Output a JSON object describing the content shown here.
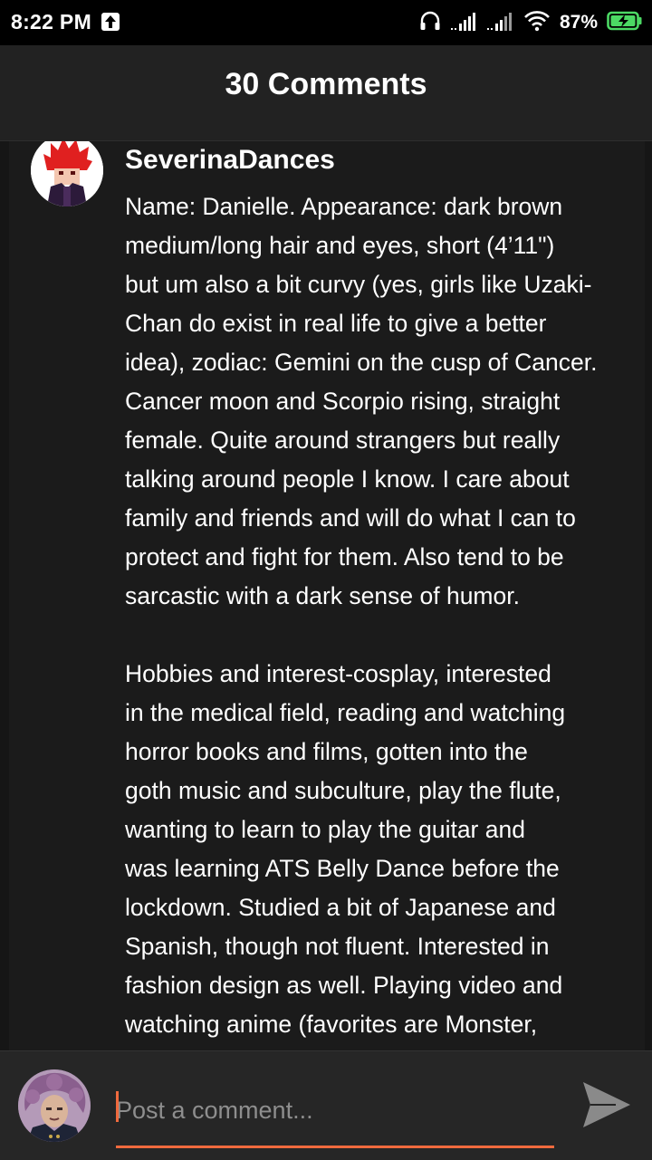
{
  "status_bar": {
    "time": "8:22 PM",
    "battery": "87%",
    "icons": [
      "upload-icon",
      "headphones-icon",
      "signal-icon",
      "signal-icon",
      "wifi-icon",
      "battery-charging-icon"
    ]
  },
  "header": {
    "title": "30 Comments"
  },
  "comment": {
    "username": "SeverinaDances",
    "lines": [
      "Name: Danielle. Appearance: dark brown",
      "medium/long hair and eyes, short (4’11\")",
      "but um also a bit curvy (yes, girls like Uzaki-",
      "Chan do exist in real life to give a better",
      "idea), zodiac: Gemini on the cusp of Cancer.",
      "Cancer moon and Scorpio rising, straight",
      "female.  Quite around strangers but really",
      "talking around people I know.  I care about",
      "family and friends and will do what I can to",
      "protect and fight for them. Also tend to be",
      "sarcastic with a dark sense of humor.",
      "",
      "Hobbies and interest-cosplay, interested",
      "in the medical field, reading and watching",
      "horror books and films, gotten into the",
      "goth music and subculture, play the flute,",
      "wanting to learn to play the guitar and",
      "was learning ATS Belly Dance before the",
      "lockdown. Studied a bit of Japanese and",
      "Spanish, though not fluent. Interested in",
      "fashion design as well.  Playing video and",
      "watching anime (favorites are Monster,"
    ]
  },
  "composer": {
    "placeholder": "Post a comment..."
  },
  "colors": {
    "background": "#1b1b1b",
    "header": "#222222",
    "accent": "#f06a3e",
    "text": "#ffffff"
  }
}
